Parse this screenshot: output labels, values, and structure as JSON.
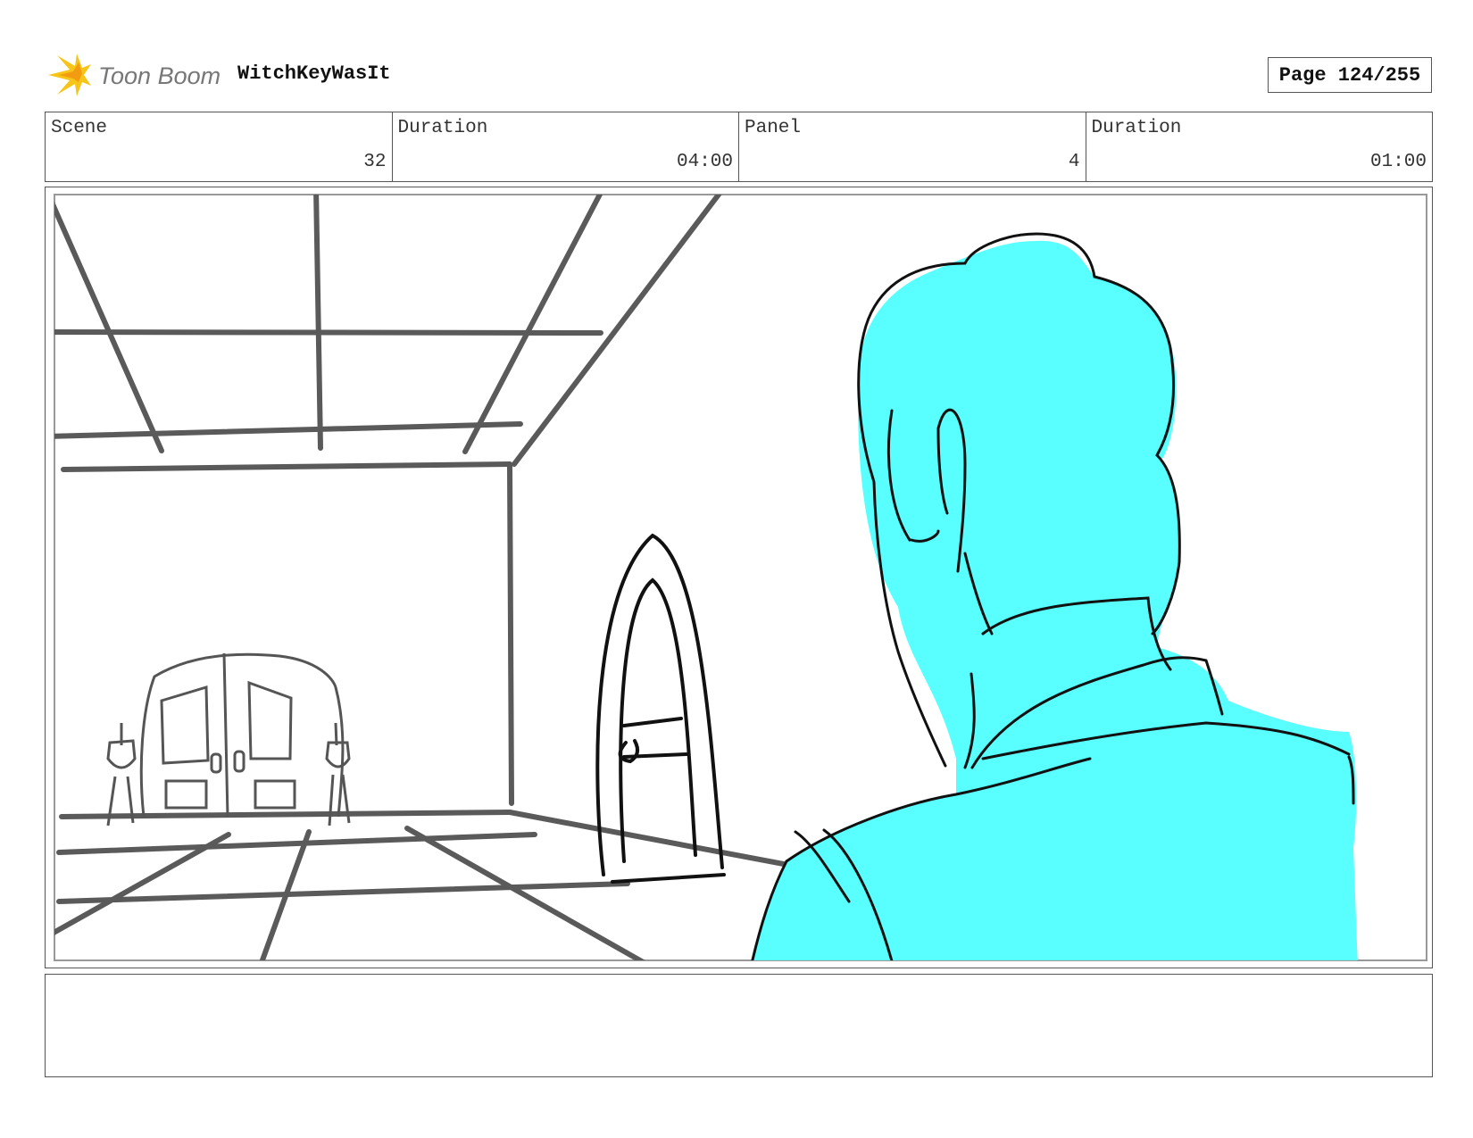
{
  "header": {
    "logo_text": "Toon Boom",
    "project_title": "WitchKeyWasIt",
    "page_label": "Page 124/255"
  },
  "info": [
    {
      "label": "Scene",
      "value": "32"
    },
    {
      "label": "Duration",
      "value": "04:00"
    },
    {
      "label": "Panel",
      "value": "4"
    },
    {
      "label": "Duration",
      "value": "01:00"
    }
  ],
  "colors": {
    "character_fill": "#59ffff",
    "sketch_gray": "#5a5a5a",
    "ink_black": "#111111"
  },
  "notes": ""
}
